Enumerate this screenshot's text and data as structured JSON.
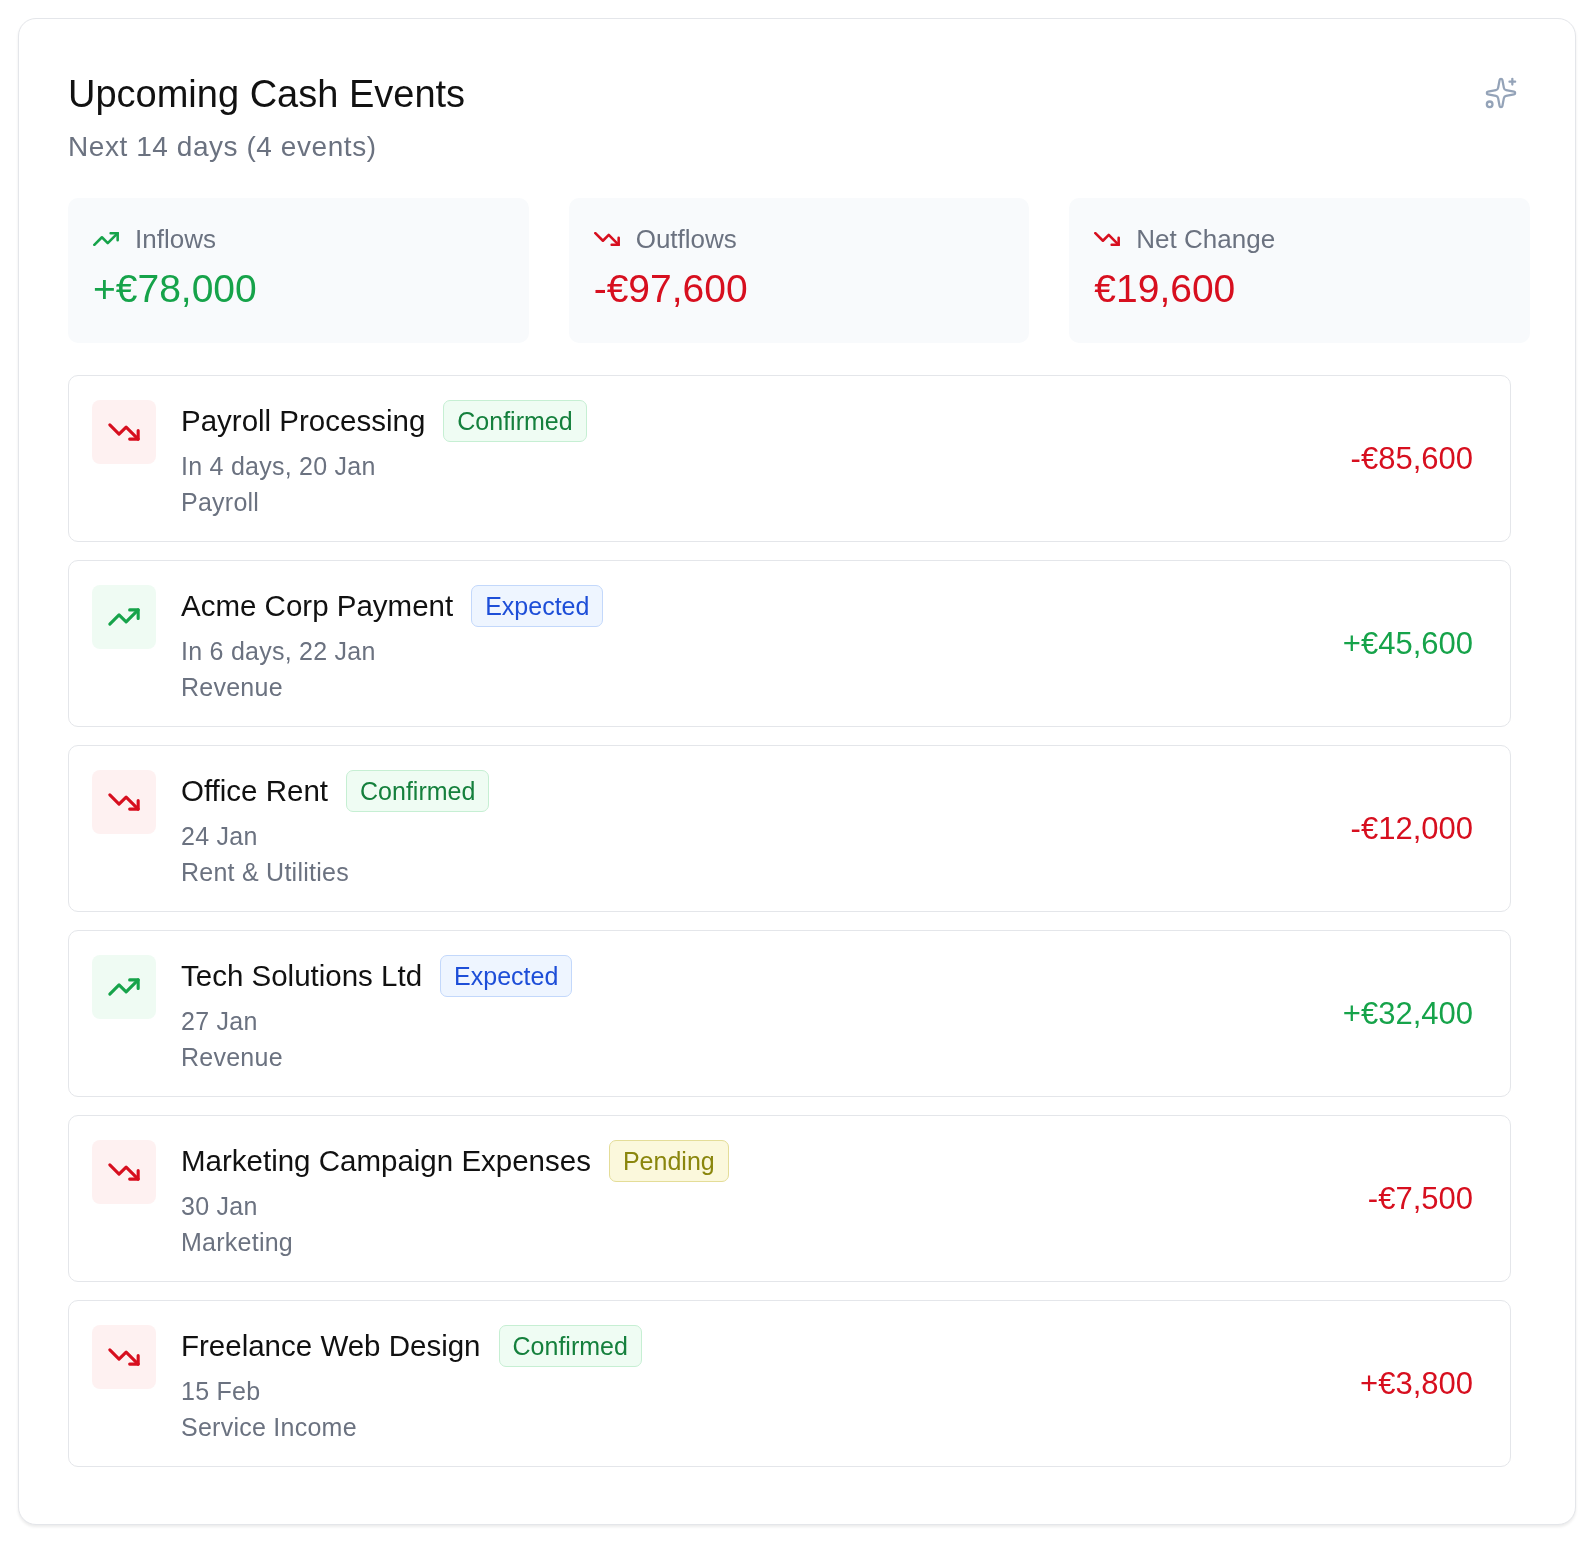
{
  "header": {
    "title": "Upcoming Cash Events",
    "subtitle": "Next 14 days (4 events)"
  },
  "summary": [
    {
      "label": "Inflows",
      "value": "+€78,000",
      "kind": "up"
    },
    {
      "label": "Outflows",
      "value": "-€97,600",
      "kind": "down"
    },
    {
      "label": "Net Change",
      "value": "€19,600",
      "kind": "down"
    }
  ],
  "events": [
    {
      "title": "Payroll Processing",
      "status": {
        "label": "Confirmed",
        "kind": "confirmed"
      },
      "date": "In 4 days, 20 Jan",
      "category": "Payroll",
      "amount": "-€85,600",
      "kind": "down"
    },
    {
      "title": "Acme Corp Payment",
      "status": {
        "label": "Expected",
        "kind": "expected"
      },
      "date": "In 6 days, 22 Jan",
      "category": "Revenue",
      "amount": "+€45,600",
      "kind": "up"
    },
    {
      "title": "Office Rent",
      "status": {
        "label": "Confirmed",
        "kind": "confirmed"
      },
      "date": "24 Jan",
      "category": "Rent & Utilities",
      "amount": "-€12,000",
      "kind": "down"
    },
    {
      "title": "Tech Solutions Ltd",
      "status": {
        "label": "Expected",
        "kind": "expected"
      },
      "date": "27 Jan",
      "category": "Revenue",
      "amount": "+€32,400",
      "kind": "up"
    },
    {
      "title": "Marketing Campaign Expenses",
      "status": {
        "label": "Pending",
        "kind": "pending"
      },
      "date": "30 Jan",
      "category": "Marketing",
      "amount": "-€7,500",
      "kind": "down"
    },
    {
      "title": "Freelance Web Design",
      "status": {
        "label": "Confirmed",
        "kind": "confirmed"
      },
      "date": "15 Feb",
      "category": "Service Income",
      "amount": "+€3,800",
      "kind": "down"
    }
  ]
}
